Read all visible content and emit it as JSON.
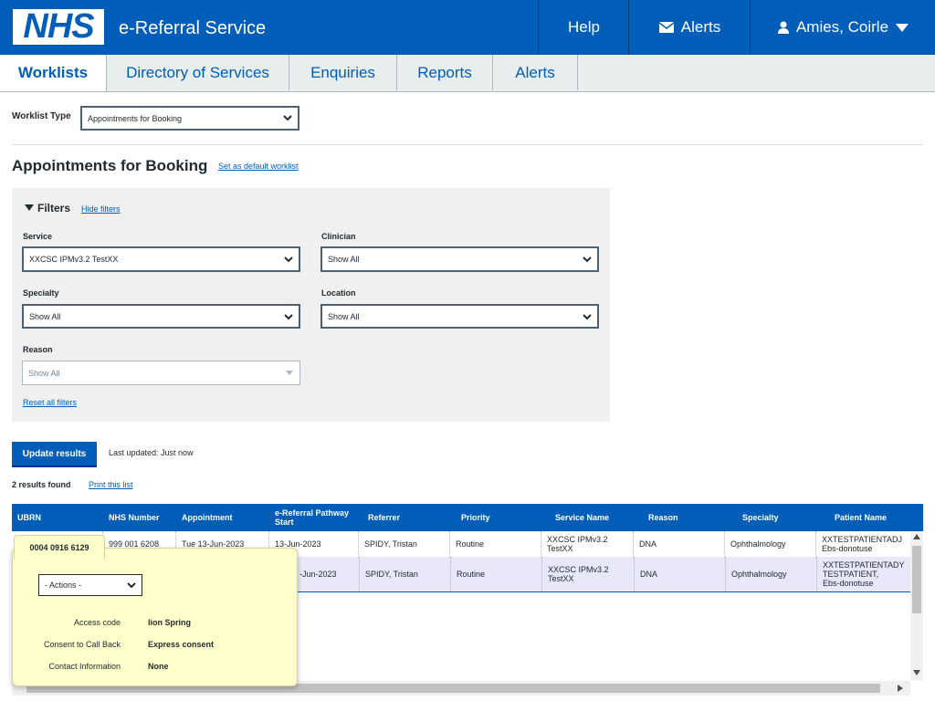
{
  "header": {
    "logo": "NHS",
    "app_title": "e-Referral Service",
    "help": "Help",
    "alerts": "Alerts",
    "user": "Amies, Coirle"
  },
  "tabs": [
    {
      "label": "Worklists"
    },
    {
      "label": "Directory of Services"
    },
    {
      "label": "Enquiries"
    },
    {
      "label": "Reports"
    },
    {
      "label": "Alerts"
    }
  ],
  "worklist_type": {
    "label": "Worklist Type",
    "value": "Appointments for Booking"
  },
  "page": {
    "title": "Appointments for Booking",
    "default_link": "Set as default worklist"
  },
  "filters": {
    "heading": "Filters",
    "hide_link": "Hide filters",
    "service": {
      "label": "Service",
      "value": "XXCSC IPMv3.2 TestXX"
    },
    "clinician": {
      "label": "Clinician",
      "value": "Show All"
    },
    "specialty": {
      "label": "Specialty",
      "value": "Show All"
    },
    "location": {
      "label": "Location",
      "value": "Show All"
    },
    "reason": {
      "label": "Reason",
      "value": "Show All"
    },
    "reset_link": "Reset all filters"
  },
  "update": {
    "button": "Update results",
    "status": "Last updated: Just now"
  },
  "results": {
    "count": "2 results found",
    "print_link": "Print this list"
  },
  "table": {
    "columns": [
      "UBRN",
      "NHS Number",
      "Appointment",
      "e-Referral Pathway Start",
      "Referrer",
      "Priority",
      "Service Name",
      "Reason",
      "Specialty",
      "Patient Name"
    ],
    "rows": [
      {
        "ubrn": "0004 0916 6129",
        "nhs": "999 001 6208",
        "appointment": "Tue 13-Jun-2023",
        "start": "13-Jun-2023",
        "referrer": "SPIDY, Tristan",
        "priority": "Routine",
        "service_1": "XXCSC IPMv3.2",
        "service_2": "TestXX",
        "reason": "DNA",
        "specialty": "Ophthalmology",
        "patient_1": "XXTESTPATIENTADJ",
        "patient_2": "Ebs-donotuse"
      },
      {
        "start": "-Jun-2023",
        "referrer": "SPIDY, Tristan",
        "priority": "Routine",
        "service_1": "XXCSC IPMv3.2",
        "service_2": "TestXX",
        "reason": "DNA",
        "specialty": "Ophthalmology",
        "patient_1": "XXTESTPATIENTADY",
        "patient_2": "TESTPATIENT,",
        "patient_3": "Ebs-donotuse"
      }
    ]
  },
  "popup": {
    "actions": "- Actions -",
    "access_code_label": "Access code",
    "access_code": "lion Spring",
    "consent_label": "Consent to Call Back",
    "consent": "Express consent",
    "contact_label": "Contact Information",
    "contact": "None"
  },
  "colors": {
    "brand": "#005eb8",
    "popup": "#ffffcc",
    "row_selected": "#e8e8f8"
  }
}
